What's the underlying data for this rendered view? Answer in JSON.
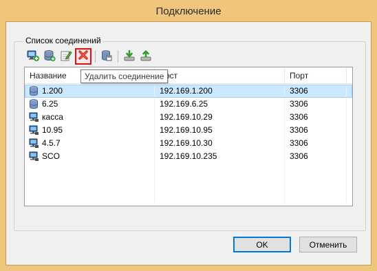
{
  "window": {
    "title": "Подключение"
  },
  "group": {
    "label": "Список соединений"
  },
  "toolbar": {
    "buttons": [
      {
        "name": "add-connection",
        "icon": "monitor-add-icon"
      },
      {
        "name": "add-database",
        "icon": "database-add-icon"
      },
      {
        "name": "edit-connection",
        "icon": "edit-icon"
      },
      {
        "name": "delete-connection",
        "icon": "red-x-delete-icon",
        "selected": true
      },
      {
        "name": "properties",
        "icon": "window-icon"
      },
      {
        "name": "import",
        "icon": "download-green-icon"
      },
      {
        "name": "export",
        "icon": "upload-green-icon"
      }
    ],
    "tooltip": "Удалить соединение"
  },
  "list": {
    "columns": {
      "name": "Название",
      "host": "Хост",
      "port": "Порт"
    },
    "rows": [
      {
        "name": "1.200",
        "host": "192.169.1.200",
        "port": "3306",
        "icon": "database-icon",
        "selected": true
      },
      {
        "name": "6.25",
        "host": "192.169.6.25",
        "port": "3306",
        "icon": "database-icon"
      },
      {
        "name": "касса",
        "host": "192.169.10.29",
        "port": "3306",
        "icon": "computer-icon"
      },
      {
        "name": "10.95",
        "host": "192.169.10.95",
        "port": "3306",
        "icon": "computer-icon"
      },
      {
        "name": "4.5.7",
        "host": "192.169.10.30",
        "port": "3306",
        "icon": "computer-icon"
      },
      {
        "name": "SCO",
        "host": "192.169.10.235",
        "port": "3306",
        "icon": "computer-icon"
      }
    ]
  },
  "buttons": {
    "ok": "OK",
    "cancel": "Отменить"
  },
  "colors": {
    "frame": "#f0c57c",
    "selection": "#cce8ff",
    "delete_highlight": "#e01010"
  }
}
